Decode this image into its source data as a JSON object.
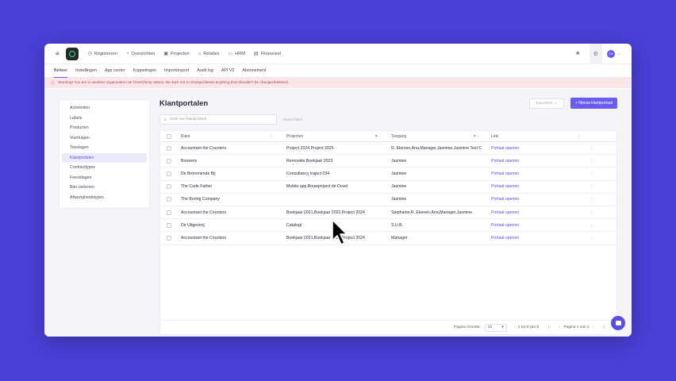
{
  "nav": {
    "items": [
      {
        "icon": "clock-icon",
        "glyph": "◷",
        "label": "Registreren"
      },
      {
        "icon": "overview-icon",
        "glyph": "◔",
        "label": "Overzichten"
      },
      {
        "icon": "projects-icon",
        "glyph": "▣",
        "label": "Projecten"
      },
      {
        "icon": "relations-icon",
        "glyph": "⌂",
        "label": "Relaties"
      },
      {
        "icon": "hrm-icon",
        "glyph": "▭",
        "label": "HRM"
      },
      {
        "icon": "finance-icon",
        "glyph": "▤",
        "label": "Financieel"
      }
    ],
    "avatar": "TA"
  },
  "subtabs": [
    "Beheer",
    "Instellingen",
    "App center",
    "Koppelingen",
    "Import/export",
    "Audit log",
    "API V2",
    "Abonnement"
  ],
  "active_subtab": 0,
  "warning": "Warning! You are in another organization as TimeChimp admin. Be sure not to change/delete anything that shouldn't be changed/deleted.",
  "sidebar": {
    "items": [
      "Activiteiten",
      "Labels",
      "Producten",
      "Voertuigen",
      "Toeslagen",
      "Klantportalen",
      "Contracttypes",
      "Feestdagen",
      "Bier-verlenen",
      "Afwezigheidstypes"
    ],
    "active": 5
  },
  "main": {
    "title": "Klantportalen",
    "export_label": "Exporteer",
    "new_button": "+ Nieuw klantportaal",
    "search_placeholder": "Zoek een klantportaal",
    "filter_label": "Reset filters"
  },
  "table": {
    "columns": [
      "Klant",
      "Projecten",
      "Toegang",
      "Link"
    ],
    "rows": [
      {
        "klant": "Accountant the Counters",
        "projecten": "Project 2024,Project 2025",
        "toegang": "R. Ekenen,Ana,Manager,Jasmine,Jasmine Test C",
        "link": "Portaal openen"
      },
      {
        "klant": "Bouwers",
        "projecten": "Renovatie,Boekjaar 2023",
        "toegang": "Jasmine",
        "link": "Portaal openen"
      },
      {
        "klant": "De Brommende Bij",
        "projecten": "Consultancy traject 034",
        "toegang": "Jasmine",
        "link": "Portaal openen"
      },
      {
        "klant": "The Code Father",
        "projecten": "Mobile app,Bouwproject de Duvel",
        "toegang": "Jasmine",
        "link": "Portaal openen"
      },
      {
        "klant": "The Boring Company",
        "projecten": "",
        "toegang": "Jasmine",
        "link": "Portaal openen"
      },
      {
        "klant": "Accountant the Counters",
        "projecten": "Boekjaar 2021,Boekjaar 2022,Project 2024",
        "toegang": "Stephanie,R. Ekenen,Ana,Manager,Jasmine",
        "link": "Portaal openen"
      },
      {
        "klant": "De Uitgeverij",
        "projecten": "Catalogi",
        "toegang": "S.U.B.",
        "link": "Portaal openen"
      },
      {
        "klant": "Accountant the Counters",
        "projecten": "Boekjaar 2021,Boekjaar 2022,Project 2024",
        "toegang": "Manager",
        "link": "Portaal openen"
      }
    ]
  },
  "pager": {
    "page_size_label": "Pagina Grootte:",
    "page_size": "10",
    "range": "1 tot 8 van 8",
    "page_label": "Pagina 1 van 1"
  },
  "colors": {
    "accent": "#6a5cf0",
    "background": "#4a3fd6",
    "warning_bg": "#fbe7ea"
  }
}
